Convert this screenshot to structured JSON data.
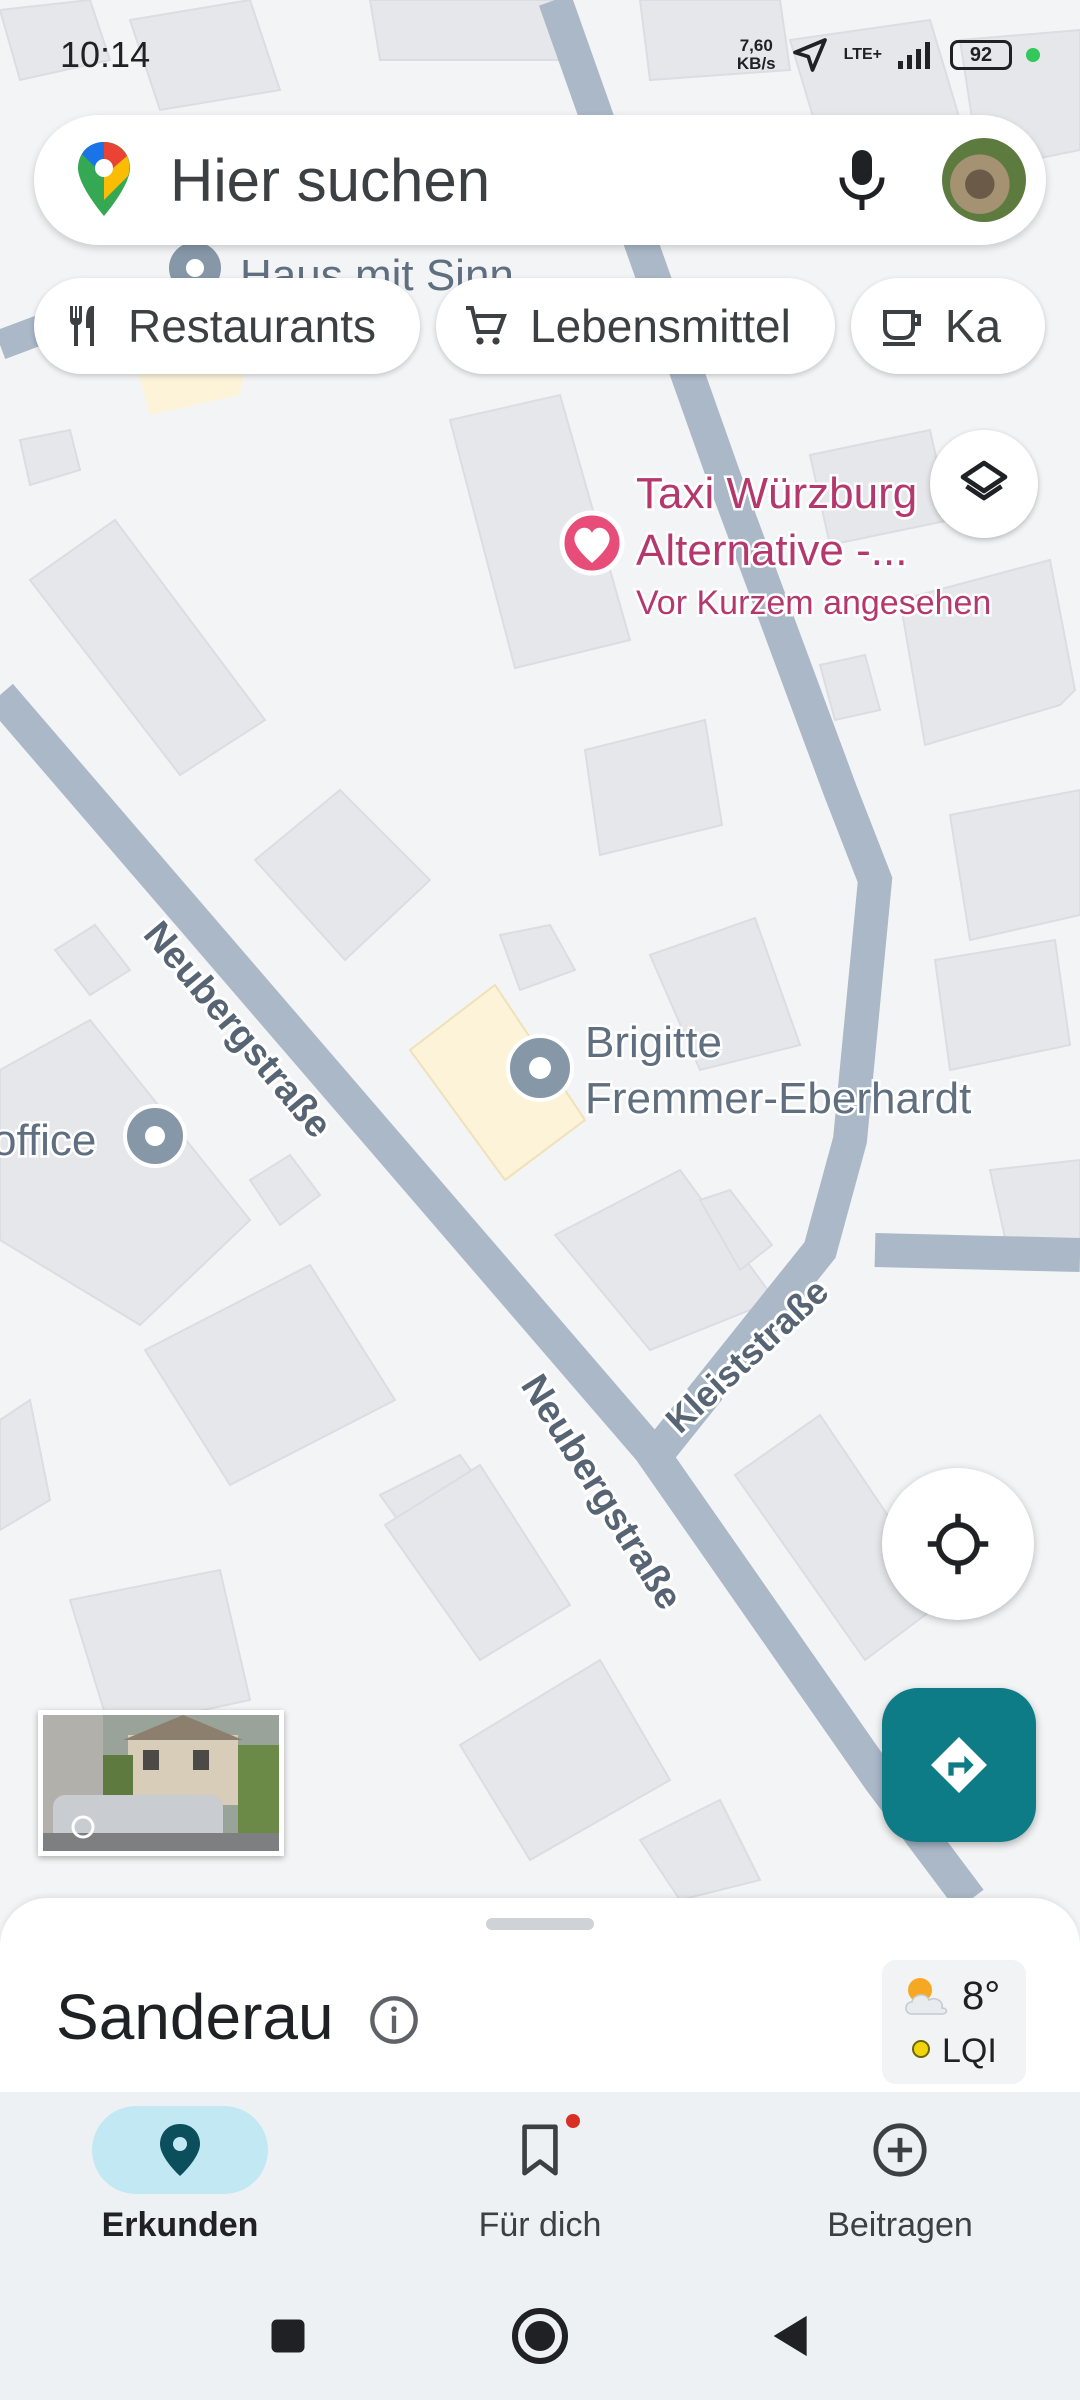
{
  "status_bar": {
    "time": "10:14",
    "net_speed_value": "7,60",
    "net_speed_unit": "KB/s",
    "network": "LTE+",
    "battery": "92"
  },
  "search": {
    "placeholder": "Hier suchen"
  },
  "chips": [
    {
      "label": "Restaurants",
      "icon": "fork-knife-icon"
    },
    {
      "label": "Lebensmittel",
      "icon": "cart-icon"
    },
    {
      "label": "Kaffee",
      "visible_label": "Ka",
      "icon": "cup-icon"
    }
  ],
  "map": {
    "poi_top": "Haus mit Sinn",
    "favorite": {
      "line1": "Taxi Würzburg",
      "line2": "Alternative -...",
      "subtitle": "Vor Kurzem angesehen"
    },
    "brigitte": {
      "line1": "Brigitte",
      "line2": "Fremmer-Eberhardt"
    },
    "office": "office",
    "street1": "Neubergstraße",
    "street2": "Neubergstraße",
    "street3": "Kleiststraße"
  },
  "sheet": {
    "place": "Sanderau",
    "temp": "8°",
    "aqi": "LQI"
  },
  "nav": {
    "explore": "Erkunden",
    "for_you": "Für dich",
    "contribute": "Beitragen"
  },
  "colors": {
    "accent": "#0e7c86",
    "favorite": "#c2185b",
    "road": "#aab8c8",
    "building": "#e7e8ec",
    "map_bg": "#f3f4f5"
  }
}
